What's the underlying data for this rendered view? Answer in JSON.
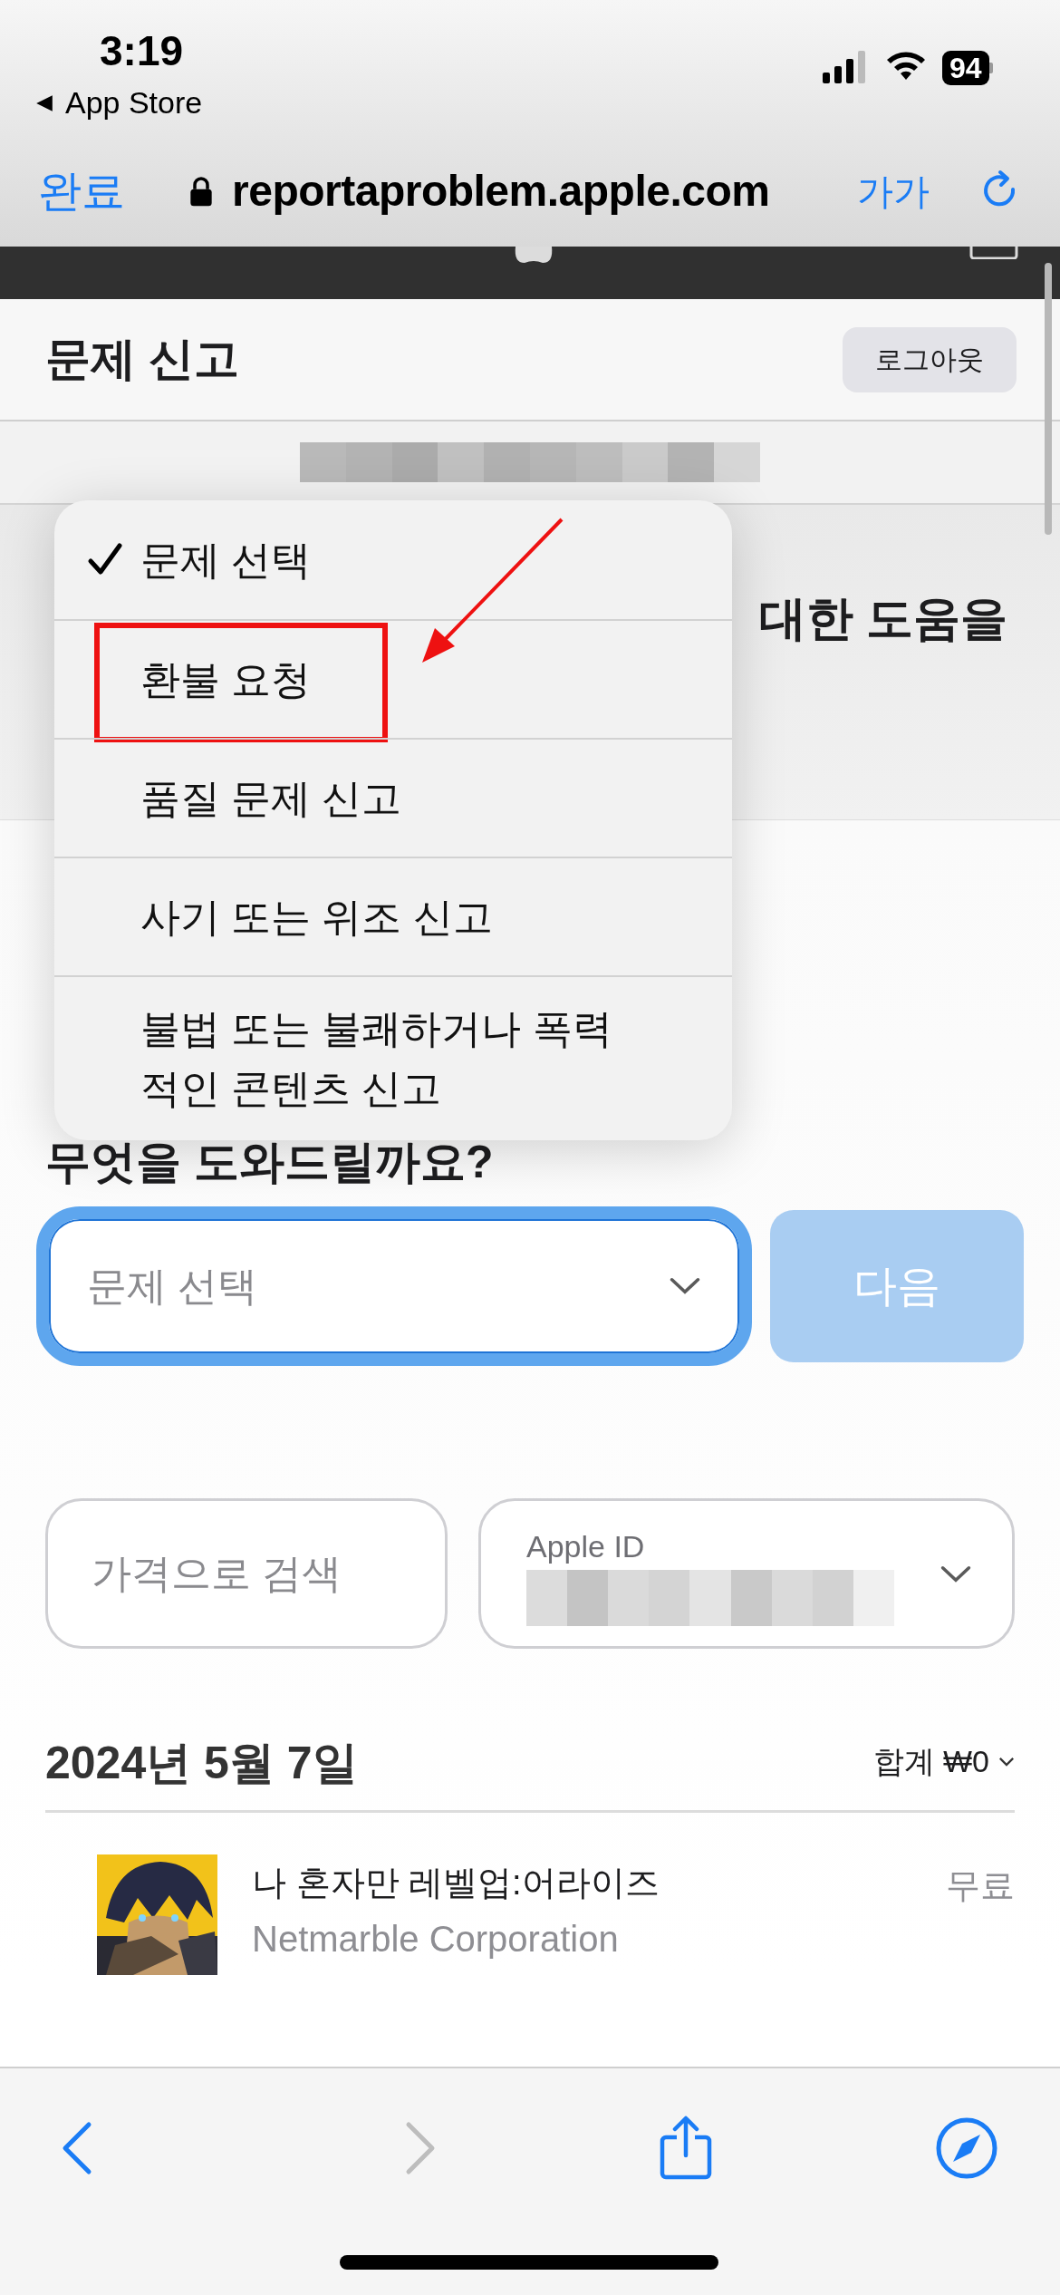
{
  "status_bar": {
    "time": "3:19",
    "back_label": "App Store",
    "battery": "94"
  },
  "browser": {
    "done_label": "완료",
    "url": "reportaproblem.apple.com",
    "text_size_label": "가가"
  },
  "page_header": {
    "title": "문제 신고",
    "logout": "로그아웃"
  },
  "hero": {
    "heading_fragment": "대한 도움을"
  },
  "dropdown": {
    "items": [
      {
        "label": "문제 선택",
        "selected": true,
        "highlighted": false
      },
      {
        "label": "환불 요청",
        "selected": false,
        "highlighted": true
      },
      {
        "label": "품질 문제 신고",
        "selected": false,
        "highlighted": false
      },
      {
        "label": "사기 또는 위조 신고",
        "selected": false,
        "highlighted": false
      },
      {
        "label": "불법 또는 불쾌하거나 폭력적인 콘텐츠 신고",
        "selected": false,
        "highlighted": false
      }
    ]
  },
  "form": {
    "question": "무엇을 도와드릴까요?",
    "select": {
      "placeholder": "문제 선택",
      "focused": true
    },
    "next_button": {
      "label": "다음",
      "disabled": true
    }
  },
  "filters": {
    "price_search": {
      "placeholder": "가격으로 검색"
    },
    "account": {
      "label": "Apple ID"
    }
  },
  "purchases": {
    "date": "2024년 5월 7일",
    "total": "합계 ₩0",
    "items": [
      {
        "title": "나 혼자만 레벨업:어라이즈",
        "developer": "Netmarble Corporation",
        "price": "무료"
      }
    ]
  },
  "toolbar": {
    "items": [
      {
        "kind": "back",
        "disabled": false
      },
      {
        "kind": "forward",
        "disabled": true
      },
      {
        "kind": "share",
        "disabled": false
      },
      {
        "kind": "compass",
        "disabled": false
      }
    ]
  }
}
